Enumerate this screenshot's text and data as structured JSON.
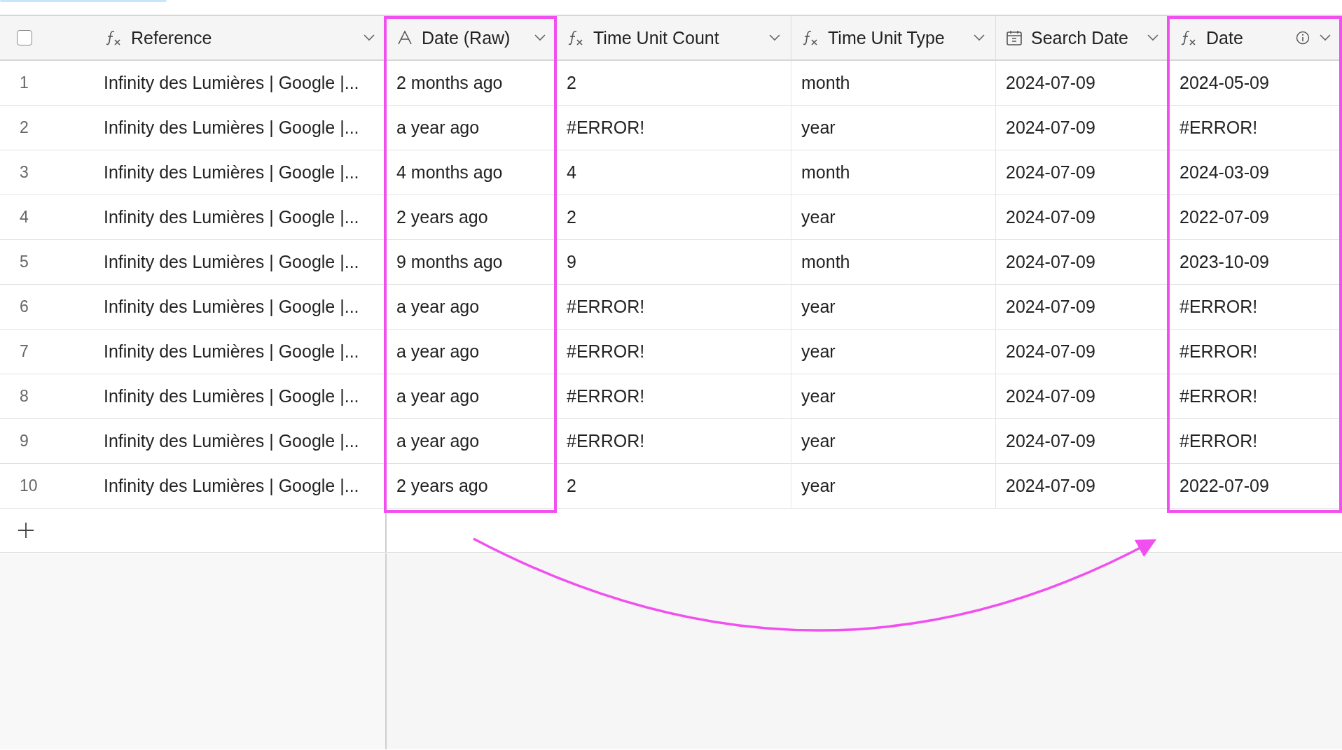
{
  "columns": [
    {
      "label": "Reference",
      "kind": "formula",
      "highlighted": false,
      "info": false
    },
    {
      "label": "Date (Raw)",
      "kind": "text",
      "highlighted": true,
      "info": false
    },
    {
      "label": "Time Unit Count",
      "kind": "formula",
      "highlighted": false,
      "info": false
    },
    {
      "label": "Time Unit Type",
      "kind": "formula",
      "highlighted": false,
      "info": false
    },
    {
      "label": "Search Date",
      "kind": "date",
      "highlighted": false,
      "info": false
    },
    {
      "label": "Date",
      "kind": "formula",
      "highlighted": true,
      "info": true
    }
  ],
  "header_checkbox": {
    "checked": false
  },
  "rows": [
    {
      "number": "1",
      "cells": [
        "Infinity des Lumières | Google |...",
        "2 months ago",
        "2",
        "month",
        "2024-07-09",
        "2024-05-09"
      ]
    },
    {
      "number": "2",
      "cells": [
        "Infinity des Lumières | Google |...",
        "a year ago",
        "#ERROR!",
        "year",
        "2024-07-09",
        "#ERROR!"
      ]
    },
    {
      "number": "3",
      "cells": [
        "Infinity des Lumières | Google |...",
        "4 months ago",
        "4",
        "month",
        "2024-07-09",
        "2024-03-09"
      ]
    },
    {
      "number": "4",
      "cells": [
        "Infinity des Lumières | Google |...",
        "2 years ago",
        "2",
        "year",
        "2024-07-09",
        "2022-07-09"
      ]
    },
    {
      "number": "5",
      "cells": [
        "Infinity des Lumières | Google |...",
        "9 months ago",
        "9",
        "month",
        "2024-07-09",
        "2023-10-09"
      ]
    },
    {
      "number": "6",
      "cells": [
        "Infinity des Lumières | Google |...",
        "a year ago",
        "#ERROR!",
        "year",
        "2024-07-09",
        "#ERROR!"
      ]
    },
    {
      "number": "7",
      "cells": [
        "Infinity des Lumières | Google |...",
        "a year ago",
        "#ERROR!",
        "year",
        "2024-07-09",
        "#ERROR!"
      ]
    },
    {
      "number": "8",
      "cells": [
        "Infinity des Lumières | Google |...",
        "a year ago",
        "#ERROR!",
        "year",
        "2024-07-09",
        "#ERROR!"
      ]
    },
    {
      "number": "9",
      "cells": [
        "Infinity des Lumières | Google |...",
        "a year ago",
        "#ERROR!",
        "year",
        "2024-07-09",
        "#ERROR!"
      ]
    },
    {
      "number": "10",
      "cells": [
        "Infinity des Lumières | Google |...",
        "2 years ago",
        "2",
        "year",
        "2024-07-09",
        "2022-07-09"
      ]
    }
  ]
}
